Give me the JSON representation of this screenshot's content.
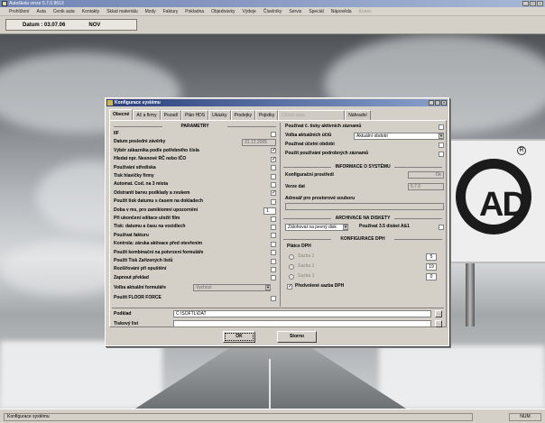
{
  "app": {
    "title": "Autoškola verze 5.7.0.9613",
    "window_controls": [
      "_",
      "□",
      "×"
    ]
  },
  "menu": [
    "Prohlížení",
    "Auta",
    "Cenik auta",
    "Kontakty",
    "Sklad materiálu",
    "Mzdy",
    "Faktury",
    "Pokladna",
    "Objednávky",
    "Výdeje",
    "Číselníky",
    "Servis",
    "Speciál",
    "Nápověda",
    "Konec"
  ],
  "date_toolbar": {
    "label": "Datum : 03.07.06",
    "day": "NOV"
  },
  "dialog": {
    "title": "Konfigurace systému",
    "tabs": [
      "Obecné",
      "Ač a firmy",
      "Pozadí",
      "Plán HDS",
      "Ukázky",
      "Prodejky",
      "Pojistky",
      "Účetní data",
      "Náhradní"
    ],
    "active_tab": 0,
    "left": {
      "section_title": "PARAMETRY",
      "rows": [
        {
          "label": "IIF",
          "type": "check",
          "checked": false
        },
        {
          "label": "Datum posledni závěrky",
          "type": "field",
          "value": "31.12.2005"
        },
        {
          "label": "Výběr zákazníka podle potřebného čísla",
          "type": "check",
          "checked": true
        },
        {
          "label": "Hledat npr. Nesnové RČ nebo IČO",
          "type": "check",
          "checked": true
        },
        {
          "label": "Používání střediska",
          "type": "check",
          "checked": false
        },
        {
          "label": "Tisk hlavičky firmy",
          "type": "check",
          "checked": false
        },
        {
          "label": "Automat. Cod. na 3 místa",
          "type": "check",
          "checked": false
        },
        {
          "label": "Odstranit barvu podklady a zvukem",
          "type": "check",
          "checked": true
        },
        {
          "label": "Použít tisk datumu s časem na dokladech",
          "type": "check",
          "checked": false
        },
        {
          "label": "Doba v ms, pro zamikiomní upozornění",
          "type": "field",
          "value": "1"
        },
        {
          "label": "Při ukončení editace uložit film",
          "type": "check",
          "checked": false
        },
        {
          "label": "Tisk: datumu a času na vozidlech",
          "type": "check",
          "checked": false
        },
        {
          "label": "Používat fakturu",
          "type": "check",
          "checked": false
        },
        {
          "label": "Kontrola: záruka aktivace před otevřením",
          "type": "check",
          "checked": false
        },
        {
          "label": "Použít kombinační na potvrzení formuláře",
          "type": "check",
          "checked": false
        },
        {
          "label": "Použít Tisk Zařízených listů",
          "type": "check",
          "checked": false
        },
        {
          "label": "Rozšiřování při opuštění",
          "type": "check",
          "checked": false
        },
        {
          "label": "Zapnout překlad",
          "type": "check",
          "checked": false
        }
      ],
      "combo_label": "Volba aktuální formuláře",
      "combo_value": "Vychozí",
      "footer_label": "Použít FLOOR FORCE"
    },
    "right": {
      "top_rows": [
        {
          "label": "Používat č. tisky aktivních záznamů",
          "type": "check",
          "checked": false
        },
        {
          "label": "Volba aktuálních účtů",
          "type": "combo",
          "value": "Aktuální období"
        },
        {
          "label": "Používat účetní obdobi",
          "type": "check",
          "checked": false
        },
        {
          "label": "Použít používání podrobných záznamů",
          "type": "check",
          "checked": false
        }
      ],
      "info_title": "INFORMACE O SYSTÉMU",
      "info_rows": [
        {
          "label": "Konfigurační prostředí",
          "value": "Ok"
        },
        {
          "label": "Verze dat",
          "value": "5.7.0"
        },
        {
          "label": "Adresář pro prostorové souboru",
          "value": ""
        }
      ],
      "archive_title": "ARCHIVACE NA DISKETY",
      "archive_combo": "Zálohovat na pevný disk",
      "archive_check_label": "Použivat 3.5 disket A&1",
      "config_title": "KONFIGURACE DPH",
      "config_sublabel": "Plátce DPH",
      "vat_rows": [
        "Sazba 1",
        "Sazba 2",
        "Sazba 3"
      ],
      "vat_values": [
        "5",
        "19",
        "0"
      ],
      "footer_label": "Předvolené sazba DPH"
    },
    "bottom": {
      "path_label": "Podklad",
      "path_value": "C:\\SOFTL\\DAT",
      "other_label": "Tiskový list",
      "other_value": ""
    },
    "ok_label": "OK",
    "cancel_label": "Storno"
  },
  "status": {
    "message": "Konfigurace systému",
    "num": "NUM"
  },
  "billboard": {
    "logo": "AD",
    "reg_mark": "R"
  }
}
